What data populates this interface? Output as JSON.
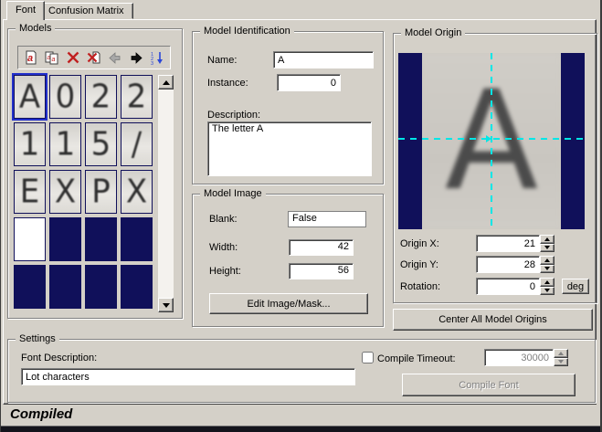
{
  "tabs": [
    {
      "label": "Font",
      "active": true
    },
    {
      "label": "Confusion Matrix",
      "active": false
    }
  ],
  "models": {
    "group_label": "Models",
    "toolbar_icons": [
      {
        "name": "new-model-icon"
      },
      {
        "name": "copy-model-icon"
      },
      {
        "name": "delete-model-icon"
      },
      {
        "name": "delete-all-models-icon"
      },
      {
        "name": "previous-model-icon"
      },
      {
        "name": "next-model-icon"
      },
      {
        "name": "sort-models-icon"
      }
    ],
    "tiles": [
      {
        "char": "A",
        "type": "image",
        "selected": true
      },
      {
        "char": "0",
        "type": "image"
      },
      {
        "char": "2",
        "type": "image"
      },
      {
        "char": "2",
        "type": "image"
      },
      {
        "char": "1",
        "type": "image"
      },
      {
        "char": "1",
        "type": "image"
      },
      {
        "char": "5",
        "type": "image"
      },
      {
        "char": "/",
        "type": "image"
      },
      {
        "char": "E",
        "type": "image"
      },
      {
        "char": "X",
        "type": "image"
      },
      {
        "char": "P",
        "type": "image"
      },
      {
        "char": "X",
        "type": "image"
      },
      {
        "char": "",
        "type": "blank-white"
      },
      {
        "char": "",
        "type": "empty"
      },
      {
        "char": "",
        "type": "empty"
      },
      {
        "char": "",
        "type": "empty"
      },
      {
        "char": "",
        "type": "empty"
      },
      {
        "char": "",
        "type": "empty"
      },
      {
        "char": "",
        "type": "empty"
      },
      {
        "char": "",
        "type": "empty"
      }
    ]
  },
  "identification": {
    "group_label": "Model Identification",
    "name_label": "Name:",
    "name_value": "A",
    "instance_label": "Instance:",
    "instance_value": "0",
    "description_label": "Description:",
    "description_value": "The letter A"
  },
  "model_image": {
    "group_label": "Model Image",
    "blank_label": "Blank:",
    "blank_value": "False",
    "width_label": "Width:",
    "width_value": "42",
    "height_label": "Height:",
    "height_value": "56",
    "edit_button": "Edit Image/Mask..."
  },
  "origin": {
    "group_label": "Model Origin",
    "preview_char": "A",
    "origin_x_label": "Origin X:",
    "origin_x_value": "21",
    "origin_y_label": "Origin Y:",
    "origin_y_value": "28",
    "rotation_label": "Rotation:",
    "rotation_value": "0",
    "deg_button": "deg",
    "center_button": "Center All Model Origins"
  },
  "settings": {
    "group_label": "Settings",
    "font_description_label": "Font Description:",
    "font_description_value": "Lot characters",
    "compile_timeout_label": "Compile Timeout:",
    "compile_timeout_checked": false,
    "compile_timeout_value": "30000",
    "compile_button": "Compile Font"
  },
  "status": {
    "text": "Compiled"
  },
  "colors": {
    "background": "#d4d0c8",
    "empty_slot_navy": "#10105a",
    "selection_blue": "#2230cc",
    "crosshair_cyan": "#00e6e6",
    "disabled_gray": "#808080",
    "delete_red": "#c02020"
  }
}
